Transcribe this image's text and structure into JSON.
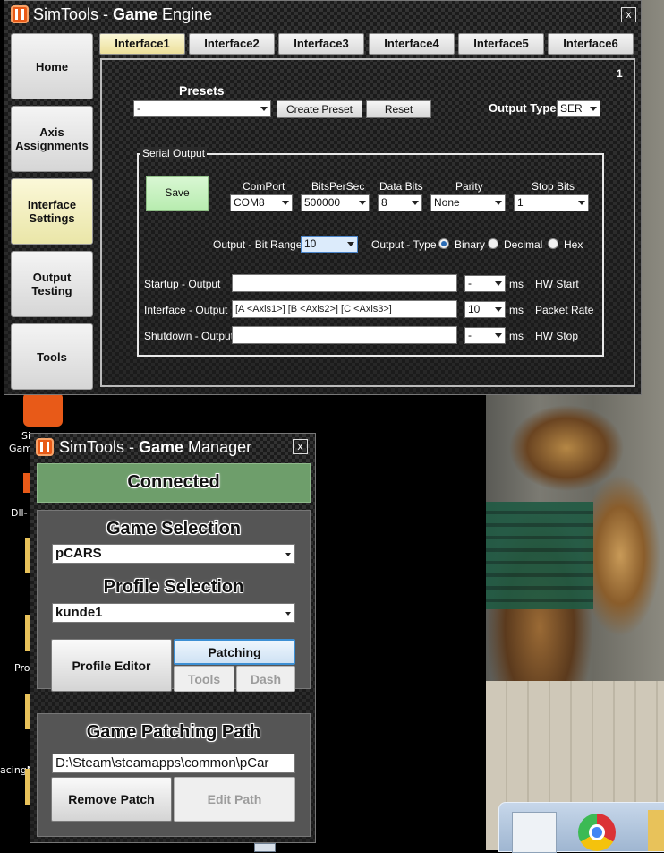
{
  "engine": {
    "title_prefix": "SimTools - ",
    "title_bold": "Game",
    "title_suffix": " Engine",
    "close": "x",
    "nav": [
      "Home",
      "Axis Assignments",
      "Interface Settings",
      "Output Testing",
      "Tools"
    ],
    "nav_active_index": 2,
    "tabs": [
      "Interface1",
      "Interface2",
      "Interface3",
      "Interface4",
      "Interface5",
      "Interface6"
    ],
    "tab_active_index": 0,
    "panel_number": "1",
    "presets": {
      "label": "Presets",
      "selected": "-",
      "create_button": "Create Preset",
      "reset_button": "Reset"
    },
    "output_type": {
      "label": "Output Type",
      "value": "SER"
    },
    "serial": {
      "group_label": "Serial Output",
      "save_button": "Save",
      "comport": {
        "label": "ComPort",
        "value": "COM8"
      },
      "bits_per_sec": {
        "label": "BitsPerSec",
        "value": "500000"
      },
      "data_bits": {
        "label": "Data Bits",
        "value": "8"
      },
      "parity": {
        "label": "Parity",
        "value": "None"
      },
      "stop_bits": {
        "label": "Stop Bits",
        "value": "1"
      },
      "bit_range": {
        "label": "Output - Bit Range",
        "value": "10"
      },
      "output_type_label": "Output - Type",
      "radio_options": [
        "Binary",
        "Decimal",
        "Hex"
      ],
      "radio_selected": "Binary",
      "rows": [
        {
          "label": "Startup - Output",
          "value": "",
          "ms_value": "-",
          "ms": "ms",
          "tail": "HW Start"
        },
        {
          "label": "Interface - Output",
          "value": "[A <Axis1>] [B <Axis2>] [C <Axis3>]",
          "ms_value": "10",
          "ms": "ms",
          "tail": "Packet Rate"
        },
        {
          "label": "Shutdown - Output",
          "value": "",
          "ms_value": "-",
          "ms": "ms",
          "tail": "HW Stop"
        }
      ]
    }
  },
  "manager": {
    "title_prefix": "SimTools - ",
    "title_bold": "Game",
    "title_suffix": " Manager",
    "close": "x",
    "status": "Connected",
    "status_color": "#6e9e6b",
    "game_selection_label": "Game Selection",
    "game_selected": "pCARS",
    "profile_selection_label": "Profile Selection",
    "profile_selected": "kunde1",
    "buttons": {
      "profile_editor": "Profile Editor",
      "patching": "Patching",
      "tools": "Tools",
      "dash": "Dash"
    },
    "patching_path_label": "Game Patching Path",
    "patching_path": "D:\\Steam\\steamapps\\common\\pCar",
    "remove_patch": "Remove Patch",
    "edit_path": "Edit Path"
  },
  "desktop": {
    "icon_labels": [
      "Si",
      "Gam",
      "Dll-",
      "Pro",
      "acingM"
    ]
  }
}
